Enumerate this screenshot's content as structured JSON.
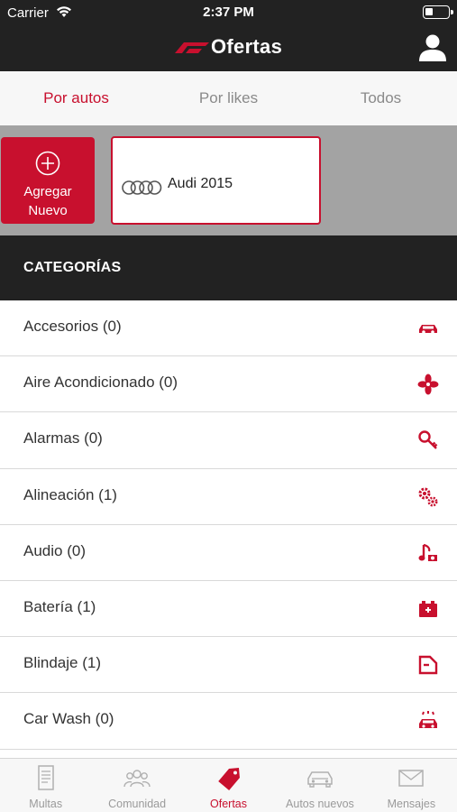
{
  "status_bar": {
    "carrier": "Carrier",
    "time": "2:37 PM"
  },
  "header": {
    "title": "Ofertas",
    "logo_icon": "wing-logo-icon",
    "profile_icon": "user-icon"
  },
  "tabs": [
    {
      "label": "Por autos",
      "active": true
    },
    {
      "label": "Por likes",
      "active": false
    },
    {
      "label": "Todos",
      "active": false
    }
  ],
  "cars": {
    "add_label": "Agregar\nNuevo",
    "items": [
      {
        "name": "Audi 2015",
        "icon": "audi-rings-icon"
      }
    ]
  },
  "categories": {
    "title": "CATEGORÍAS",
    "items": [
      {
        "label": "Accesorios (0)",
        "icon": "car-icon"
      },
      {
        "label": "Aire Acondicionado (0)",
        "icon": "fan-icon"
      },
      {
        "label": "Alarmas (0)",
        "icon": "key-icon"
      },
      {
        "label": "Alineación (1)",
        "icon": "gears-icon"
      },
      {
        "label": "Audio (0)",
        "icon": "music-icon"
      },
      {
        "label": "Batería (1)",
        "icon": "battery-icon"
      },
      {
        "label": "Blindaje (1)",
        "icon": "shield-tag-icon"
      },
      {
        "label": "Car Wash (0)",
        "icon": "car-wash-icon"
      }
    ]
  },
  "bottom_nav": [
    {
      "label": "Multas",
      "icon": "document-icon",
      "active": false
    },
    {
      "label": "Comunidad",
      "icon": "community-icon",
      "active": false
    },
    {
      "label": "Ofertas",
      "icon": "tag-icon",
      "active": true
    },
    {
      "label": "Autos nuevos",
      "icon": "car-front-icon",
      "active": false
    },
    {
      "label": "Mensajes",
      "icon": "envelope-icon",
      "active": false
    }
  ],
  "colors": {
    "accent": "#c8102e",
    "dark": "#222222",
    "strip": "#a3a3a3"
  }
}
